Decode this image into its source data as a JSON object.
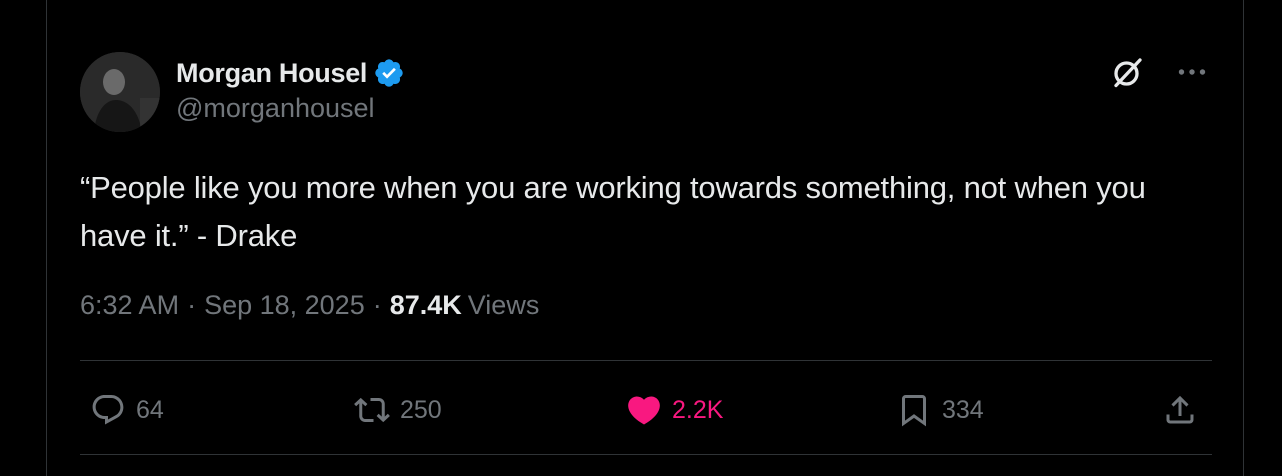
{
  "author": {
    "display_name": "Morgan Housel",
    "handle": "@morganhousel",
    "verified": true,
    "verified_color": "#1d9bf0"
  },
  "tweet": {
    "text": "“People like you more when you are working towards something, not when you have it.” - Drake",
    "time": "6:32 AM",
    "separator": "·",
    "date": "Sep 18, 2025",
    "views_count": "87.4K",
    "views_label": "Views"
  },
  "actions": {
    "reply": {
      "count": "64",
      "icon": "reply-icon"
    },
    "retweet": {
      "count": "250",
      "icon": "retweet-icon"
    },
    "like": {
      "count": "2.2K",
      "icon": "heart-filled-icon",
      "liked": true,
      "color": "#f91880"
    },
    "bookmark": {
      "count": "334",
      "icon": "bookmark-icon"
    },
    "share": {
      "icon": "share-icon"
    }
  },
  "top_actions": {
    "grok": {
      "icon": "grok-icon"
    },
    "more": {
      "icon": "more-icon"
    }
  },
  "colors": {
    "background": "#000000",
    "text_primary": "#e7e9ea",
    "text_secondary": "#71767b",
    "divider": "#2f3336",
    "like_pink": "#f91880",
    "verified_blue": "#1d9bf0"
  }
}
